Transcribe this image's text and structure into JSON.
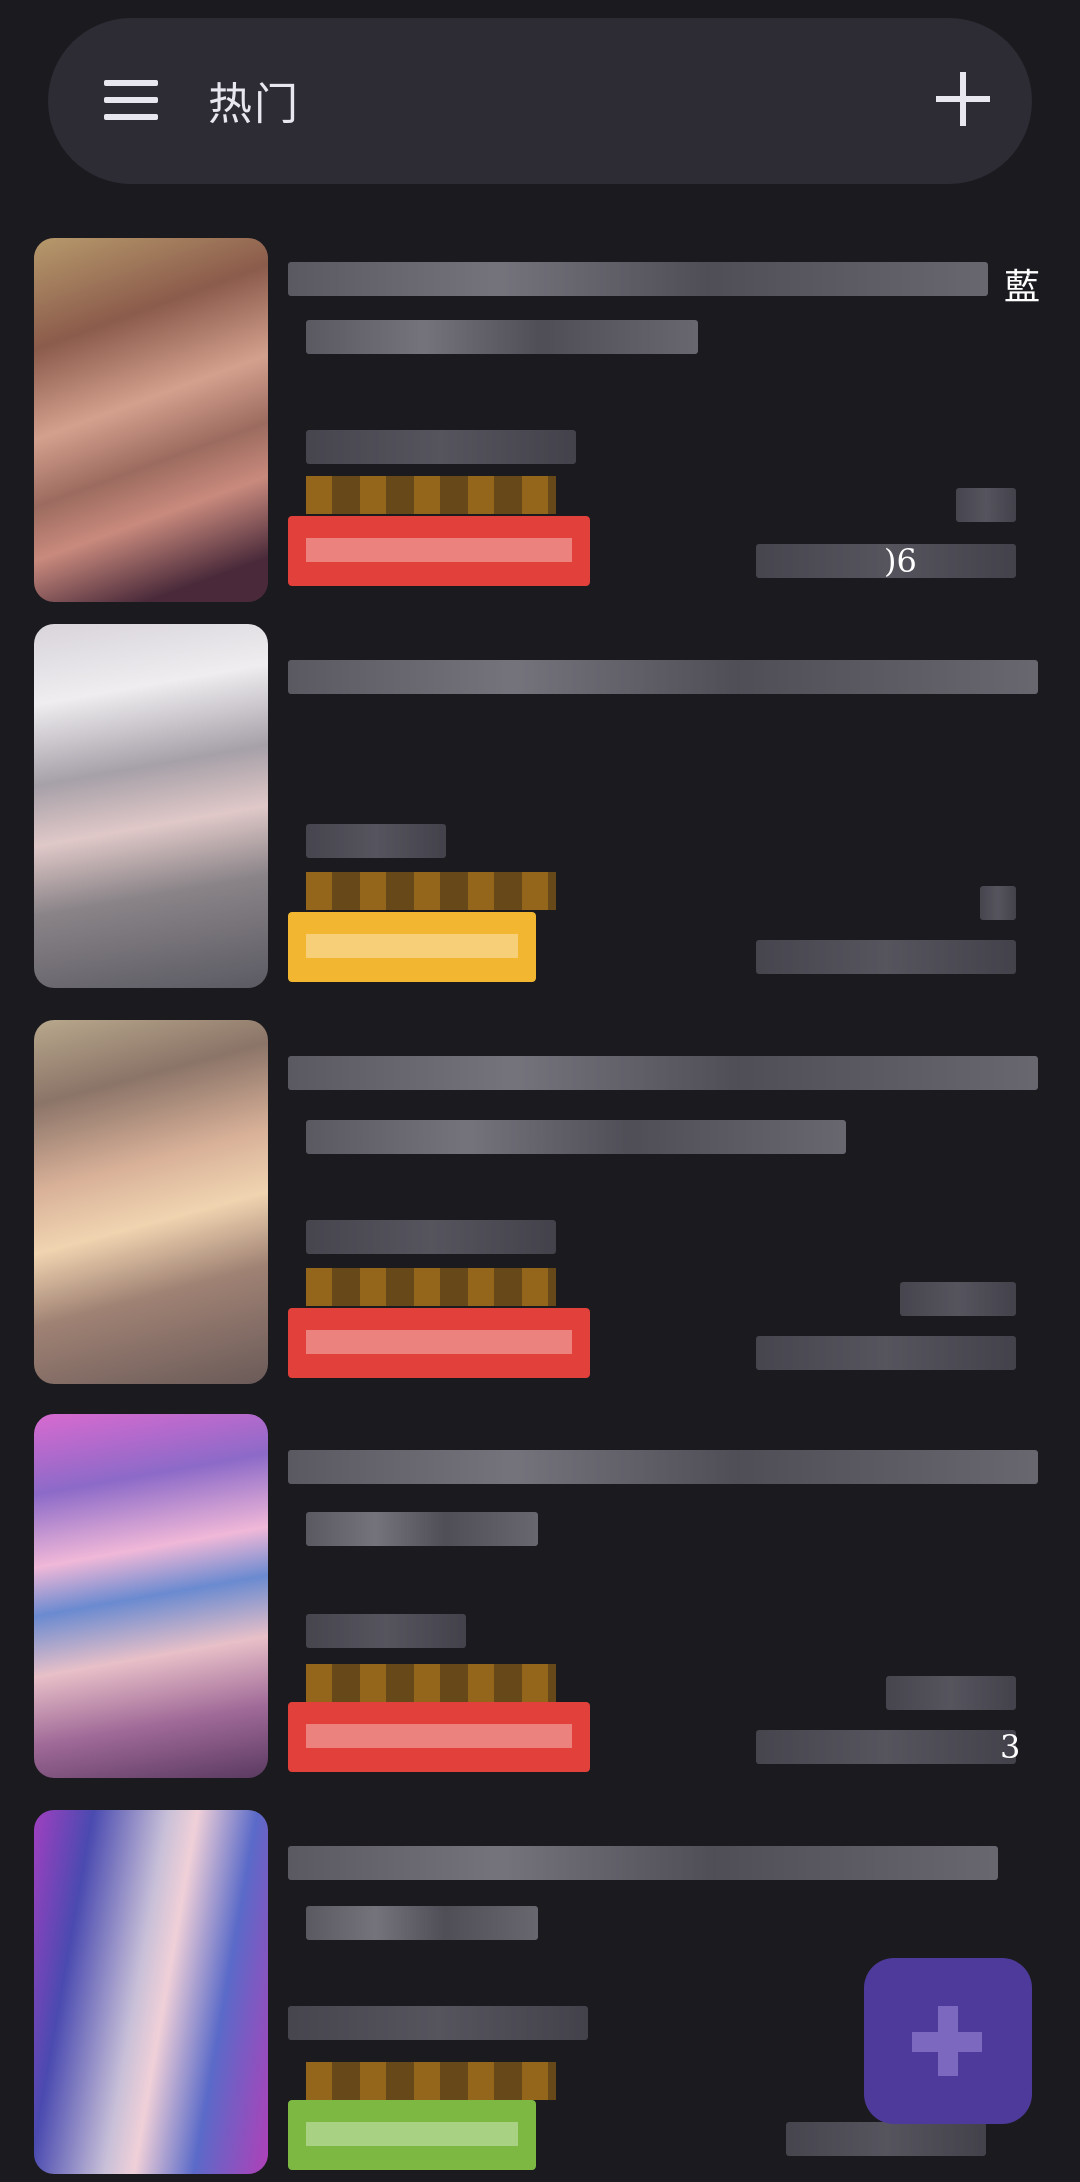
{
  "app_bar": {
    "title": "热门",
    "menu_icon": "menu-icon",
    "add_icon": "plus-icon"
  },
  "items": [
    {
      "title_suffix": "藍",
      "meta_suffix": ")6",
      "badge_color": "#e2403a"
    },
    {
      "title_suffix": "",
      "meta_suffix": "",
      "badge_color": "#f2b631"
    },
    {
      "title_suffix": "",
      "meta_suffix": "",
      "badge_color": "#e2403a"
    },
    {
      "title_suffix": "",
      "meta_suffix": "3",
      "badge_color": "#e2403a"
    },
    {
      "title_suffix": "",
      "meta_suffix": "",
      "badge_color": "#7cb842"
    }
  ],
  "fab": {
    "icon": "plus-icon"
  },
  "colors": {
    "background": "#1b1a1f",
    "app_bar": "#2d2b33",
    "fab": "#4e3a9a",
    "stars": "#9a6a1c"
  }
}
